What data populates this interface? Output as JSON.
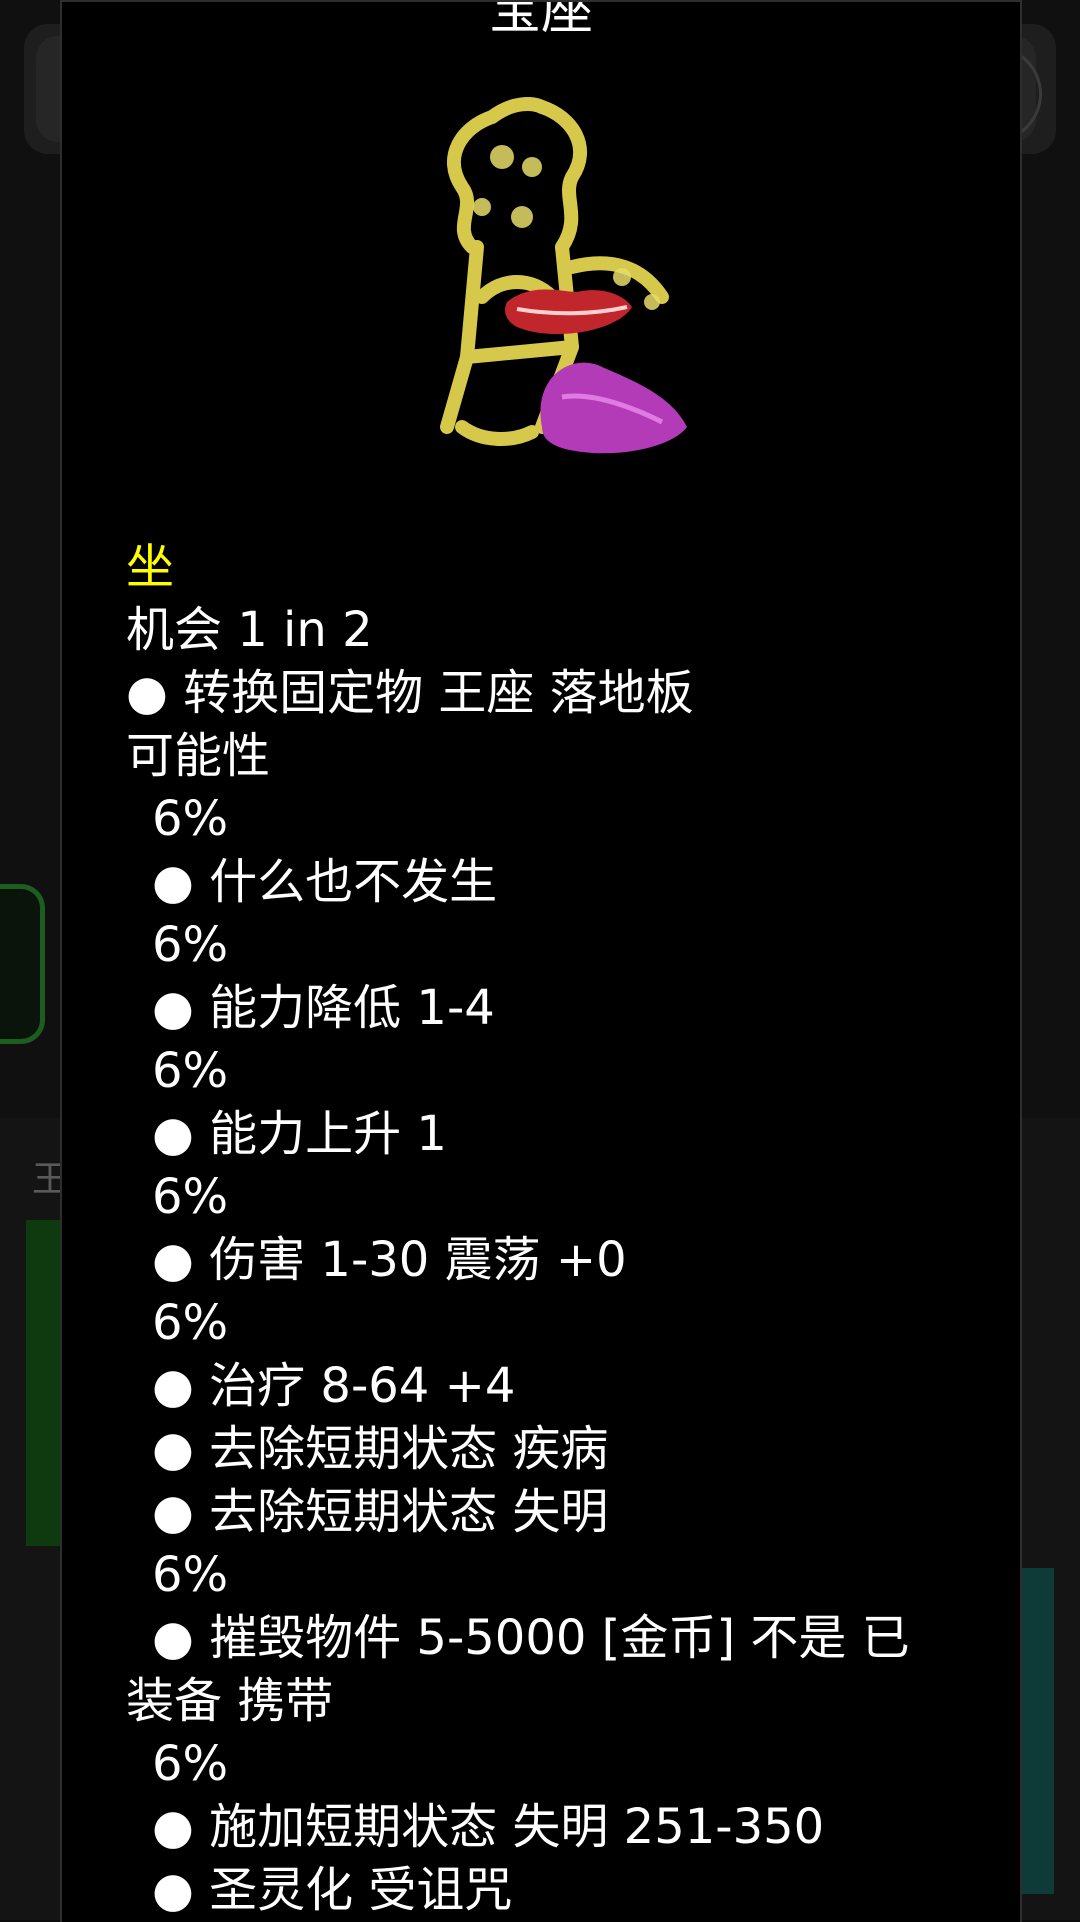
{
  "dialog": {
    "title": "宝座",
    "action_name": "坐",
    "chance": "机会 1 in 2",
    "convert_line": "● 转换固定物 王座 落地板",
    "possibility_label": "可能性",
    "outcomes": [
      {
        "percent": "6%",
        "effects": [
          "● 什么也不发生"
        ]
      },
      {
        "percent": "6%",
        "effects": [
          "● 能力降低 1-4"
        ]
      },
      {
        "percent": "6%",
        "effects": [
          "● 能力上升 1"
        ]
      },
      {
        "percent": "6%",
        "effects": [
          "● 伤害 1-30 震荡 +0"
        ]
      },
      {
        "percent": "6%",
        "effects": [
          "● 治疗 8-64 +4",
          "● 去除短期状态 疾病",
          "● 去除短期状态 失明"
        ]
      },
      {
        "percent": "6%",
        "effects": [
          "● 摧毁物件 5-5000 [金币] 不是 已装备 携带"
        ]
      },
      {
        "percent": "6%",
        "effects": [
          "● 施加短期状态 失明 251-350",
          "● 圣灵化 受诅咒"
        ]
      }
    ]
  },
  "background": {
    "lower_label": "王"
  },
  "colors": {
    "accent_yellow": "#ffff00",
    "throne_gold": "#d6c84a",
    "lips_red": "#c0262c",
    "cushion_purple": "#b43bb8"
  }
}
